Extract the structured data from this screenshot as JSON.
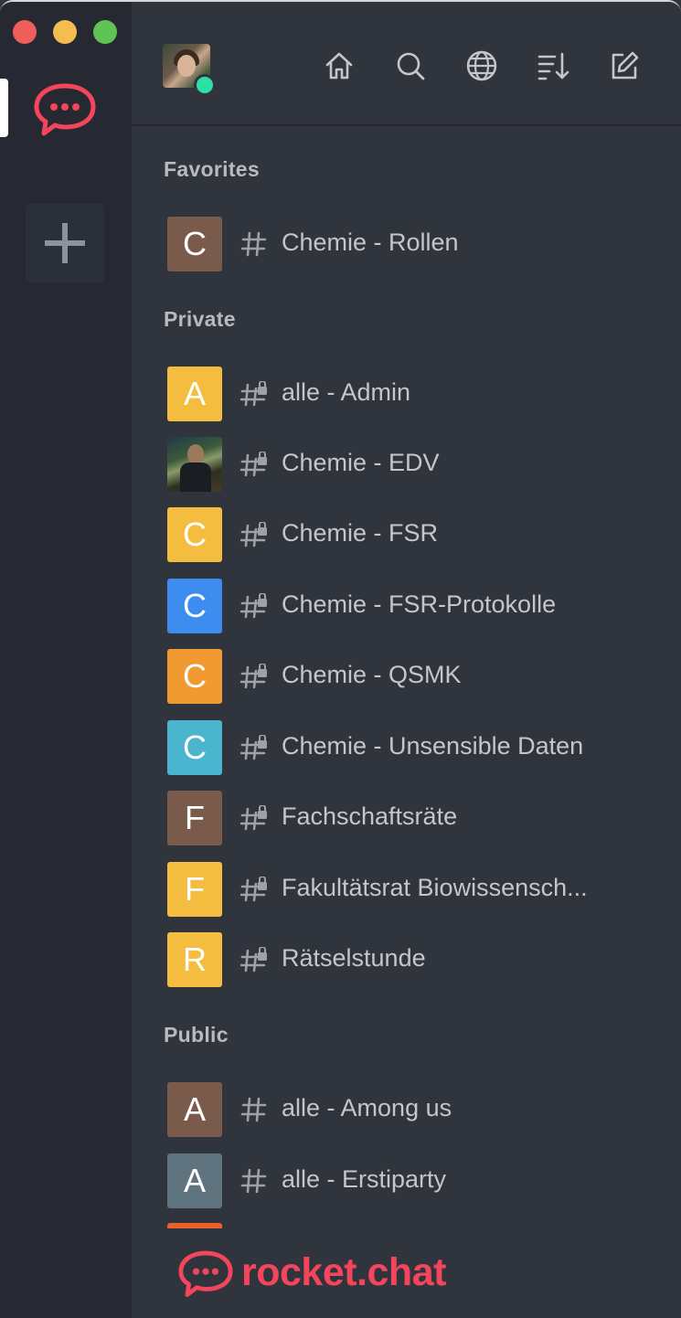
{
  "window": {
    "controls": [
      "close",
      "minimize",
      "zoom"
    ]
  },
  "rail": {
    "servers": [
      {
        "icon": "rocket-chat-logo-icon",
        "active": true
      }
    ],
    "add_label": "+"
  },
  "header": {
    "user_status": "online",
    "icons": [
      "home-icon",
      "search-icon",
      "globe-icon",
      "sort-icon",
      "compose-icon"
    ]
  },
  "sections": {
    "favorites": {
      "title": "Favorites",
      "rooms": [
        {
          "initial": "C",
          "name": "Chemie - Rollen",
          "color": "#7a5a4a",
          "private": false
        }
      ]
    },
    "private": {
      "title": "Private",
      "rooms": [
        {
          "initial": "A",
          "name": "alle - Admin",
          "color": "#f5bd3f",
          "private": true
        },
        {
          "initial": "",
          "name": "Chemie - EDV",
          "color": "photo",
          "private": true
        },
        {
          "initial": "C",
          "name": "Chemie - FSR",
          "color": "#f5bd3f",
          "private": true
        },
        {
          "initial": "C",
          "name": "Chemie - FSR-Protokolle",
          "color": "#3d8cf0",
          "private": true
        },
        {
          "initial": "C",
          "name": "Chemie - QSMK",
          "color": "#f19a2f",
          "private": true
        },
        {
          "initial": "C",
          "name": "Chemie - Unsensible Daten",
          "color": "#4ab5cf",
          "private": true
        },
        {
          "initial": "F",
          "name": "Fachschaftsräte",
          "color": "#7a5a4a",
          "private": true
        },
        {
          "initial": "F",
          "name": "Fakultätsrat Biowissensch...",
          "color": "#f5bd3f",
          "private": true
        },
        {
          "initial": "R",
          "name": "Rätselstunde",
          "color": "#f5bd3f",
          "private": true
        }
      ]
    },
    "public": {
      "title": "Public",
      "rooms": [
        {
          "initial": "A",
          "name": "alle - Among us",
          "color": "#7a5a4a",
          "private": false
        },
        {
          "initial": "A",
          "name": "alle - Erstiparty",
          "color": "#607480",
          "private": false
        }
      ]
    }
  },
  "footer": {
    "brand": "rocket.chat",
    "brand_color": "#f5455c"
  }
}
